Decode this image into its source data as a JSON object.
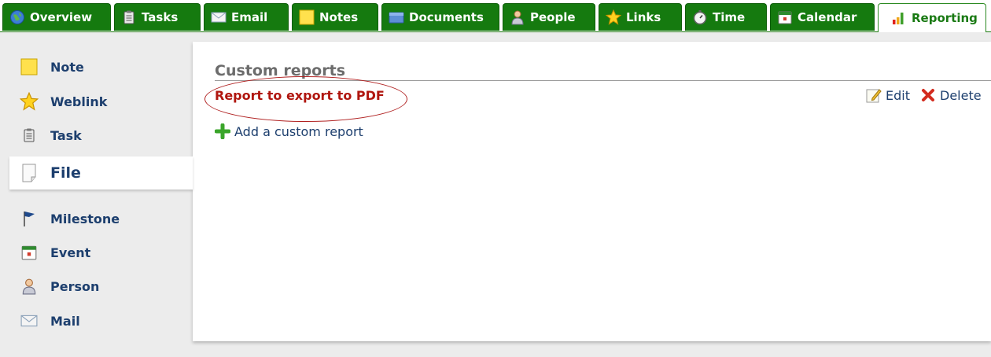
{
  "tabs": [
    {
      "label": "Overview",
      "icon": "globe-icon"
    },
    {
      "label": "Tasks",
      "icon": "clipboard-icon"
    },
    {
      "label": "Email",
      "icon": "envelope-icon"
    },
    {
      "label": "Notes",
      "icon": "sticky-note-icon"
    },
    {
      "label": "Documents",
      "icon": "folder-icon"
    },
    {
      "label": "People",
      "icon": "person-icon"
    },
    {
      "label": "Links",
      "icon": "star-icon"
    },
    {
      "label": "Time",
      "icon": "stopwatch-icon"
    },
    {
      "label": "Calendar",
      "icon": "calendar-icon"
    },
    {
      "label": "Reporting",
      "icon": "bar-chart-icon",
      "active": true
    }
  ],
  "sidebar": {
    "items": [
      {
        "label": "Note",
        "icon": "sticky-note-icon"
      },
      {
        "label": "Weblink",
        "icon": "star-icon"
      },
      {
        "label": "Task",
        "icon": "clipboard-icon"
      },
      {
        "label": "File",
        "icon": "file-icon",
        "active": true
      },
      {
        "label": "Milestone",
        "icon": "flag-icon"
      },
      {
        "label": "Event",
        "icon": "calendar-icon"
      },
      {
        "label": "Person",
        "icon": "person-icon"
      },
      {
        "label": "Mail",
        "icon": "envelope-icon"
      }
    ]
  },
  "main": {
    "heading": "Custom reports",
    "report": {
      "label": "Report to export to PDF"
    },
    "edit_label": "Edit",
    "delete_label": "Delete",
    "add_label": "Add a custom report"
  },
  "colors": {
    "tab_green": "#157a0f",
    "link_blue": "#1d3f6e",
    "report_red": "#b0160f"
  }
}
